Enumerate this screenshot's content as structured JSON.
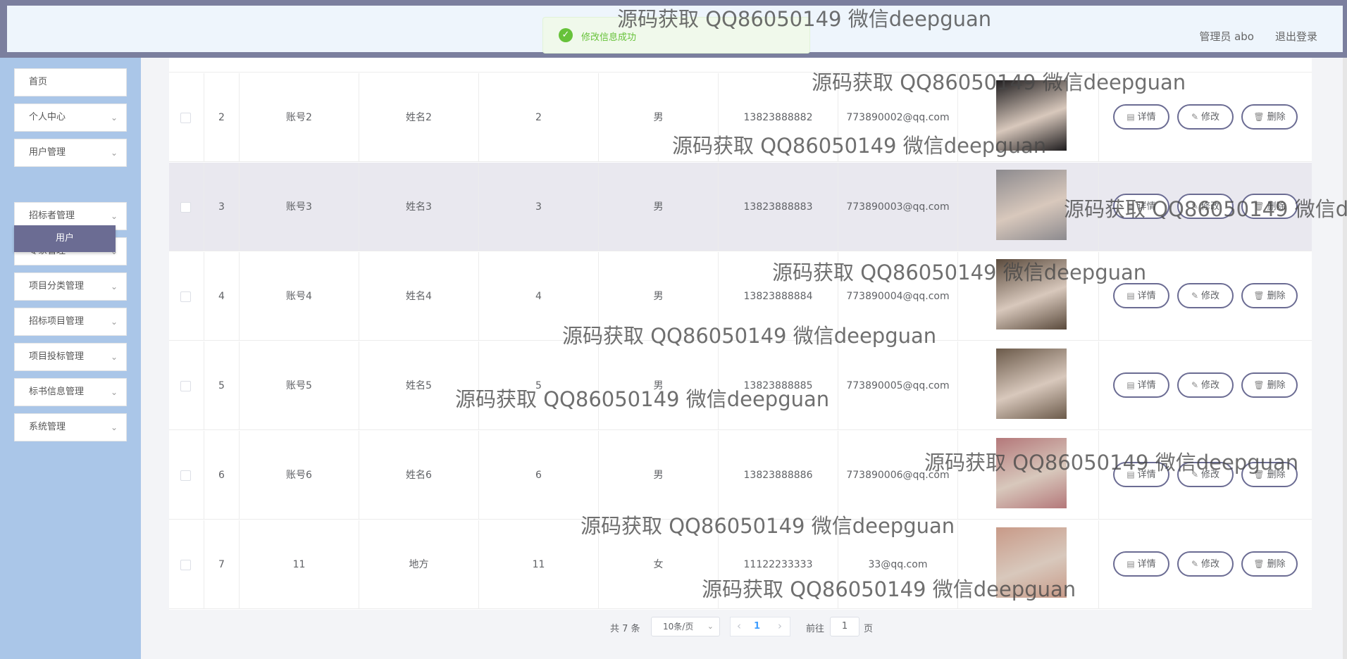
{
  "header": {
    "user": "管理员 abo",
    "logout": "退出登录"
  },
  "toast": {
    "message": "修改信息成功"
  },
  "sidebar": {
    "items": [
      {
        "label": "首页",
        "has_chevron": false
      },
      {
        "label": "个人中心",
        "has_chevron": true
      },
      {
        "label": "用户管理",
        "has_chevron": true
      },
      {
        "label": "招标者管理",
        "has_chevron": true
      },
      {
        "label": "专家管理",
        "has_chevron": true
      },
      {
        "label": "项目分类管理",
        "has_chevron": true
      },
      {
        "label": "招标项目管理",
        "has_chevron": true
      },
      {
        "label": "项目投标管理",
        "has_chevron": true
      },
      {
        "label": "标书信息管理",
        "has_chevron": true
      },
      {
        "label": "系统管理",
        "has_chevron": true
      }
    ],
    "active_sub": "用户"
  },
  "table": {
    "rows": [
      {
        "index": "2",
        "account": "账号2",
        "name": "姓名2",
        "age": "2",
        "gender": "男",
        "phone": "13823888882",
        "email": "773890002@qq.com",
        "avatar_color": "#1e1c1e"
      },
      {
        "index": "3",
        "account": "账号3",
        "name": "姓名3",
        "age": "3",
        "gender": "男",
        "phone": "13823888883",
        "email": "773890003@qq.com",
        "avatar_color": "#8c8a8e"
      },
      {
        "index": "4",
        "account": "账号4",
        "name": "姓名4",
        "age": "4",
        "gender": "男",
        "phone": "13823888884",
        "email": "773890004@qq.com",
        "avatar_color": "#5a4a3c"
      },
      {
        "index": "5",
        "account": "账号5",
        "name": "姓名5",
        "age": "5",
        "gender": "男",
        "phone": "13823888885",
        "email": "773890005@qq.com",
        "avatar_color": "#6b5a4a"
      },
      {
        "index": "6",
        "account": "账号6",
        "name": "姓名6",
        "age": "6",
        "gender": "男",
        "phone": "13823888886",
        "email": "773890006@qq.com",
        "avatar_color": "#b4787a"
      },
      {
        "index": "7",
        "account": "11",
        "name": "地方",
        "age": "11",
        "gender": "女",
        "phone": "11122233333",
        "email": "33@qq.com",
        "avatar_color": "#c89a88"
      }
    ],
    "buttons": {
      "detail": "详情",
      "edit": "修改",
      "delete": "删除"
    }
  },
  "pagination": {
    "total": "共 7 条",
    "page_size": "10条/页",
    "current": "1",
    "goto_prefix": "前往",
    "goto_value": "1",
    "goto_suffix": "页"
  },
  "watermark": "源码获取 QQ86050149 微信deepguan",
  "colors": {
    "accent": "#6b6c93",
    "sidebar": "#aac6e8",
    "success": "#67c23a"
  }
}
